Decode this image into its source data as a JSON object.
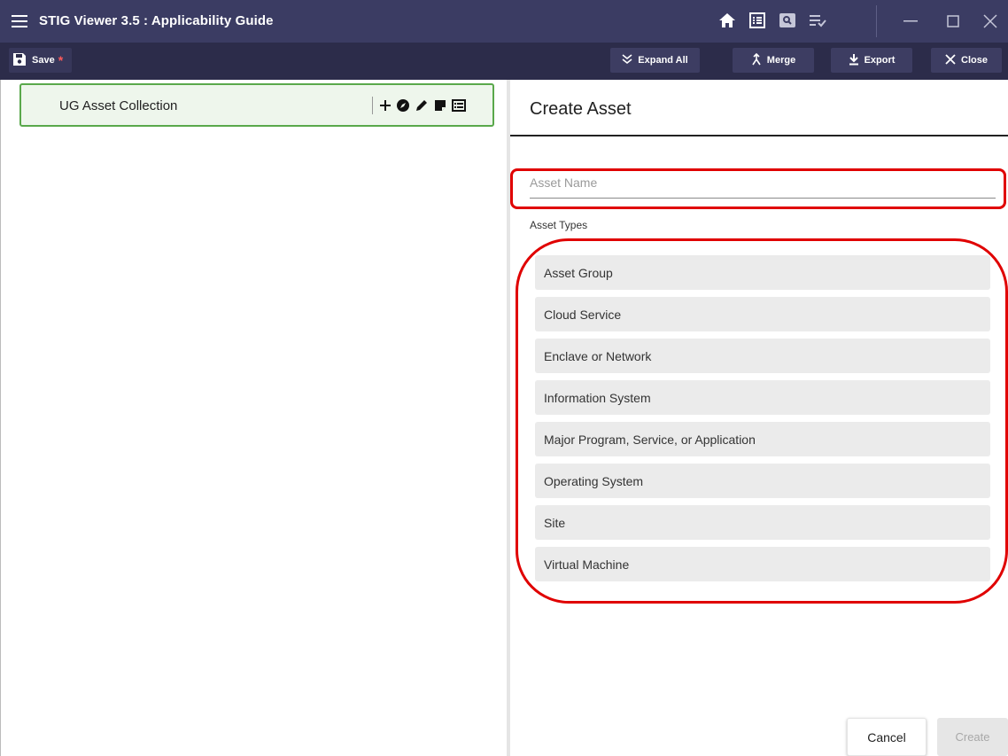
{
  "app": {
    "title": "STIG Viewer 3.5 : Applicability Guide"
  },
  "titlebar": {
    "icons": [
      "menu-icon",
      "home-icon",
      "list-view-icon",
      "search-view-icon",
      "checklist-icon",
      "minimize-icon",
      "maximize-icon",
      "close-icon"
    ]
  },
  "toolbar": {
    "save_label": "Save",
    "save_modified": "*",
    "expand_label": "Expand All",
    "merge_label": "Merge",
    "export_label": "Export",
    "close_label": "Close"
  },
  "tree": {
    "collection_label": "UG Asset Collection",
    "actions": [
      "add-icon",
      "compass-icon",
      "edit-icon",
      "note-icon",
      "list-icon"
    ]
  },
  "form": {
    "title": "Create Asset",
    "asset_name_placeholder": "Asset Name",
    "asset_name_value": "",
    "asset_types_label": "Asset Types",
    "asset_types": [
      "Asset Group",
      "Cloud Service",
      "Enclave or Network",
      "Information System",
      "Major Program, Service, or Application",
      "Operating System",
      "Site",
      "Virtual Machine"
    ],
    "cancel_label": "Cancel",
    "create_label": "Create"
  },
  "colors": {
    "titlebar": "#3b3c63",
    "toolbar": "#2c2c4a",
    "collection_border": "#59a84b",
    "highlight": "#e00000"
  }
}
